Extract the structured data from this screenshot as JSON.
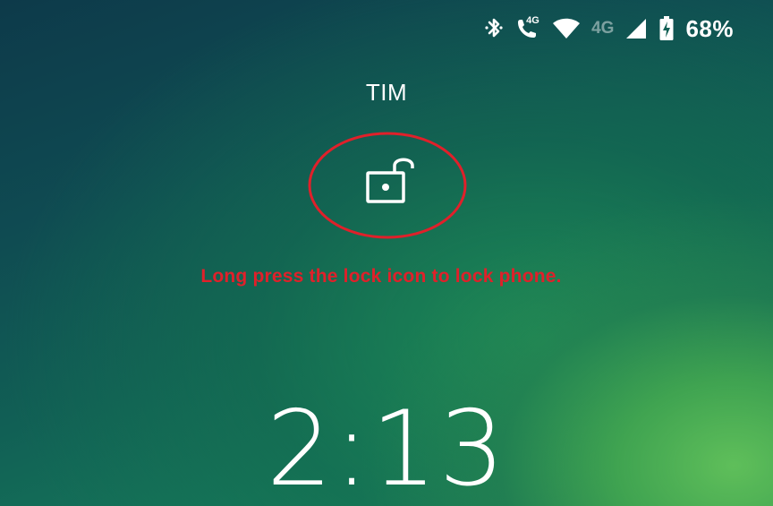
{
  "status_bar": {
    "icons": [
      "bluetooth-icon",
      "wifi-calling-4g-icon",
      "wifi-icon",
      "mobile-signal-4g-icon",
      "battery-charging-icon"
    ],
    "call_network_label": "4G",
    "signal_network_label": "4G",
    "battery_percent": "68%"
  },
  "lockscreen": {
    "carrier": "TIM",
    "lock_icon": "unlocked-padlock-icon",
    "hint": "Long press the lock icon to lock phone.",
    "clock": "2:13"
  },
  "colors": {
    "annotation": "#e0202a",
    "text": "#ffffff"
  }
}
